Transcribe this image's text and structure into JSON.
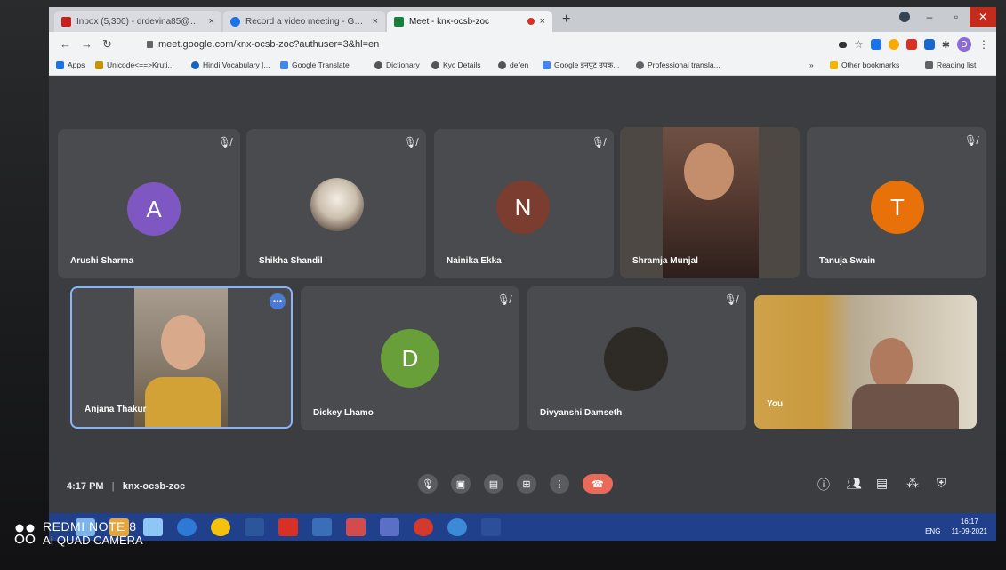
{
  "browser": {
    "tabs": [
      {
        "title": "Inbox (5,300) - drdevina85@gma",
        "favicon_color": "#c5221f"
      },
      {
        "title": "Record a video meeting - Google",
        "favicon_color": "#1a73e8"
      },
      {
        "title": "Meet - knx-ocsb-zoc",
        "favicon_color": "#188038"
      }
    ],
    "new_tab": "+",
    "url": "meet.google.com/knx-ocsb-zoc?authuser=3&hl=en",
    "profile_initial": "D",
    "bookmarks": [
      "Apps",
      "Unicode<==>Kruti...",
      "Hindi Vocabulary |...",
      "Google Translate",
      "Dictionary",
      "Kyc Details",
      "defen",
      "Google इनपुट उपक...",
      "Professional transla..."
    ],
    "other_bookmarks": "Other bookmarks",
    "reading_list": "Reading list"
  },
  "meet": {
    "time": "4:17 PM",
    "separator": "|",
    "code": "knx-ocsb-zoc",
    "participants_row1": [
      {
        "name": "Arushi Sharma",
        "initial": "A",
        "color": "#7e57c2",
        "muted": true
      },
      {
        "name": "Shikha Shandil",
        "initial": "",
        "color": "#d9d2c7",
        "muted": true
      },
      {
        "name": "Nainika Ekka",
        "initial": "N",
        "color": "#8d4a3a",
        "muted": true
      },
      {
        "name": "Shramja Munjal",
        "initial": "",
        "color": "#6d4c41",
        "muted": false
      },
      {
        "name": "Tanuja Swain",
        "initial": "T",
        "color": "#e8710a",
        "muted": true
      }
    ],
    "participants_row2": [
      {
        "name": "Anjana Thakur",
        "initial": "",
        "color": "#c9a56f",
        "muted": false
      },
      {
        "name": "Dickey Lhamo",
        "initial": "D",
        "color": "#689f38",
        "muted": true
      },
      {
        "name": "Divyanshi Damseth",
        "initial": "",
        "color": "#2e2a26",
        "muted": true
      },
      {
        "name": "You",
        "initial": "",
        "color": "#b58a3a",
        "muted": false
      }
    ]
  },
  "taskbar": {
    "lang": "ENG",
    "clock_time": "16:17",
    "clock_date": "11-09-2021"
  },
  "watermark": {
    "line1": "REDMI NOTE 8",
    "line2": "AI QUAD CAMERA"
  }
}
